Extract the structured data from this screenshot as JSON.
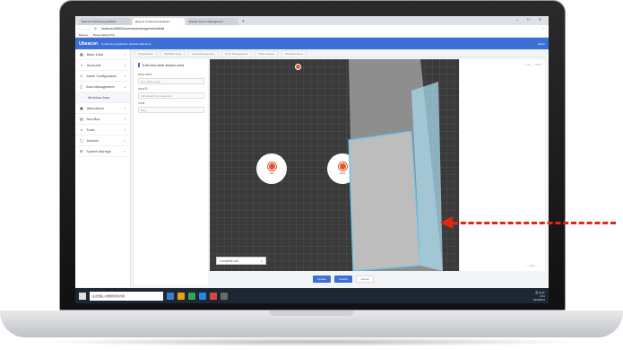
{
  "browser": {
    "tabs": [
      {
        "label": "Beacon Positioning Applicati...",
        "active": false
      },
      {
        "label": "Beacon Positioning Applicati...",
        "active": true
      },
      {
        "label": "Display Server Management",
        "active": false
      }
    ],
    "new_tab": "+",
    "window_controls": "— ☐ ✕",
    "url": "localhost:8080/home/areamanage/area/detail",
    "bookmarks": [
      "Beacon",
      "Beacon(EasyCM)"
    ]
  },
  "app": {
    "logo": "Ubeacon",
    "name": "Positioning Application Software Backend",
    "user": "admin"
  },
  "sidebar": {
    "items": [
      {
        "label": "Basic Data",
        "icon": "grid-icon",
        "has_children": true
      },
      {
        "label": "Accounts",
        "icon": "person-icon",
        "has_children": true
      },
      {
        "label": "Alarm Configuration",
        "icon": "alert-icon",
        "has_children": true
      },
      {
        "label": "Area Management",
        "icon": "area-icon",
        "has_children": true
      },
      {
        "label": "Workflow Area",
        "icon": "",
        "has_children": false,
        "sub": true
      },
      {
        "label": "Attendance",
        "icon": "calendar-icon",
        "has_children": true
      },
      {
        "label": "Non-Bus",
        "icon": "bus-icon",
        "has_children": true
      },
      {
        "label": "Track",
        "icon": "track-icon",
        "has_children": true
      },
      {
        "label": "Devices",
        "icon": "device-icon",
        "has_children": true
      },
      {
        "label": "System Manage",
        "icon": "gear-icon",
        "has_children": true
      }
    ]
  },
  "crumbs": [
    "Organization",
    "Workflow Area",
    "Area Management",
    "Tools Management",
    "Video Source",
    "Workflow Area"
  ],
  "form": {
    "title": "Edit new-time station area",
    "fields": [
      {
        "label": "Area name",
        "value": "Fire_Work_area"
      },
      {
        "label": "Area ID",
        "value": "Scheduled Fire Inspection"
      },
      {
        "label": "Color",
        "value": "Blue"
      }
    ]
  },
  "canvas": {
    "nodes": [
      {
        "label": "LBS"
      },
      {
        "label": "APFS"
      }
    ],
    "dropdown_value": "Complete set",
    "dropdown_caret": "∨"
  },
  "rightpanel": {
    "top_label": "1.00 ↔ 100%",
    "bottom_label": "— 10m —"
  },
  "buttons": {
    "update": "Update",
    "confirm": "Confirm",
    "cancel": "Cancel"
  },
  "taskbar": {
    "search_placeholder": "在这里输入你要搜索的内容",
    "time": "9:42",
    "date": "2020/8/11",
    "tray_icons": "英 ⊞ 🔊"
  },
  "colors": {
    "primary": "#3d6fd8",
    "marker": "#e2552c",
    "arrow": "#e3260e",
    "selection": "#5dc3f0"
  }
}
